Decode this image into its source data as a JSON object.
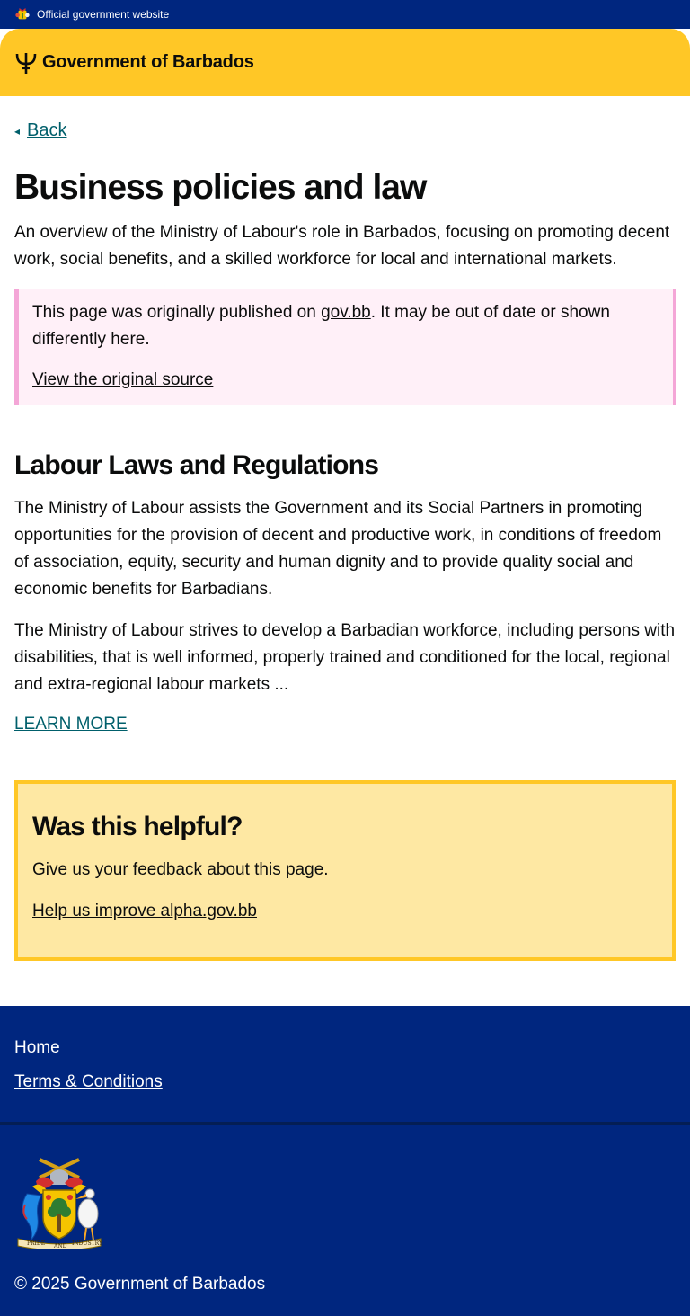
{
  "topbar": {
    "label": "Official government website",
    "icon": "barbados-crest-icon"
  },
  "header": {
    "title": "Government of Barbados",
    "icon": "trident-icon"
  },
  "nav": {
    "back_label": "Back",
    "back_icon": "arrow-left-icon"
  },
  "page": {
    "title": "Business policies and law",
    "lead": "An overview of the Ministry of Labour's role in Barbados, focusing on promoting decent work, social benefits, and a skilled workforce for local and international markets."
  },
  "notice": {
    "text_before": "This page was originally published on ",
    "link_text": "gov.bb",
    "text_after": ". It may be out of date or shown differently here.",
    "source_link": "View the original source"
  },
  "section": {
    "title": "Labour Laws and Regulations",
    "paragraphs": [
      "The Ministry of Labour assists the Government and its Social Partners in promoting opportunities for the provision of decent and productive work, in conditions of freedom of association, equity, security and human dignity and to provide quality social and economic benefits for Barbadians.",
      "The Ministry of Labour strives to develop a Barbadian workforce, including persons with disabilities, that is well informed, properly trained and conditioned for the local, regional and extra-regional labour markets ..."
    ],
    "learn_more": "LEARN MORE"
  },
  "feedback": {
    "title": "Was this helpful?",
    "text": "Give us your feedback about this page.",
    "link": "Help us improve alpha.gov.bb"
  },
  "footer": {
    "links": [
      "Home",
      "Terms & Conditions"
    ],
    "copyright": "© 2025 Government of Barbados",
    "motto": [
      "PRIDE",
      "AND",
      "INDUSTRY"
    ]
  },
  "colors": {
    "navy": "#00267f",
    "yellow": "#ffc726",
    "teal_link": "#005f6b",
    "notice_bg": "#fff0f8",
    "notice_border": "#f4a6d7",
    "feedback_bg": "#fee8a3"
  }
}
